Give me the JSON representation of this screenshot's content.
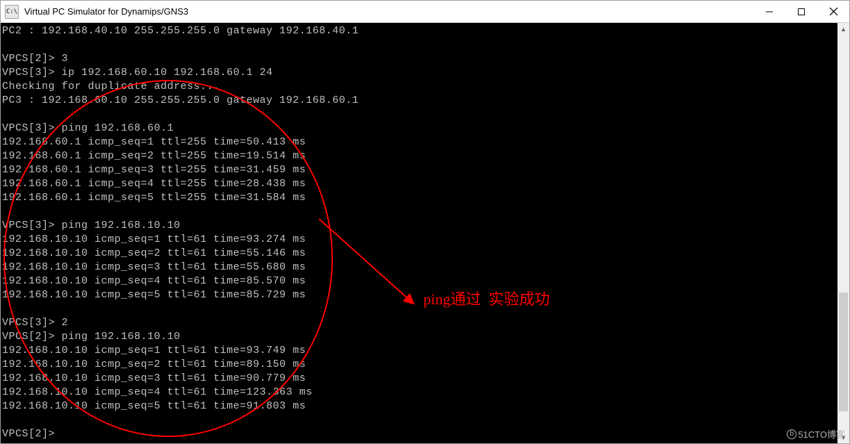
{
  "window": {
    "app_icon_label": "C:\\",
    "title": "Virtual PC Simulator for Dynamips/GNS3"
  },
  "terminal": {
    "lines": [
      "PC2 : 192.168.40.10 255.255.255.0 gateway 192.168.40.1",
      "",
      "VPCS[2]> 3",
      "VPCS[3]> ip 192.168.60.10 192.168.60.1 24",
      "Checking for duplicate address...",
      "PC3 : 192.168.60.10 255.255.255.0 gateway 192.168.60.1",
      "",
      "VPCS[3]> ping 192.168.60.1",
      "192.168.60.1 icmp_seq=1 ttl=255 time=50.413 ms",
      "192.168.60.1 icmp_seq=2 ttl=255 time=19.514 ms",
      "192.168.60.1 icmp_seq=3 ttl=255 time=31.459 ms",
      "192.168.60.1 icmp_seq=4 ttl=255 time=28.438 ms",
      "192.168.60.1 icmp_seq=5 ttl=255 time=31.584 ms",
      "",
      "VPCS[3]> ping 192.168.10.10",
      "192.168.10.10 icmp_seq=1 ttl=61 time=93.274 ms",
      "192.168.10.10 icmp_seq=2 ttl=61 time=55.146 ms",
      "192.168.10.10 icmp_seq=3 ttl=61 time=55.680 ms",
      "192.168.10.10 icmp_seq=4 ttl=61 time=85.570 ms",
      "192.168.10.10 icmp_seq=5 ttl=61 time=85.729 ms",
      "",
      "VPCS[3]> 2",
      "VPCS[2]> ping 192.168.10.10",
      "192.168.10.10 icmp_seq=1 ttl=61 time=93.749 ms",
      "192.168.10.10 icmp_seq=2 ttl=61 time=89.150 ms",
      "192.168.10.10 icmp_seq=3 ttl=61 time=90.779 ms",
      "192.168.10.10 icmp_seq=4 ttl=61 time=123.363 ms",
      "192.168.10.10 icmp_seq=5 ttl=61 time=91.803 ms",
      "",
      "VPCS[2]>"
    ]
  },
  "annotation": {
    "label": "ping通过  实验成功"
  },
  "watermark": {
    "text": "51CTO博客"
  },
  "colors": {
    "annotation": "#ff0000",
    "terminal_bg": "#000000",
    "terminal_fg": "#c0c0c0"
  }
}
